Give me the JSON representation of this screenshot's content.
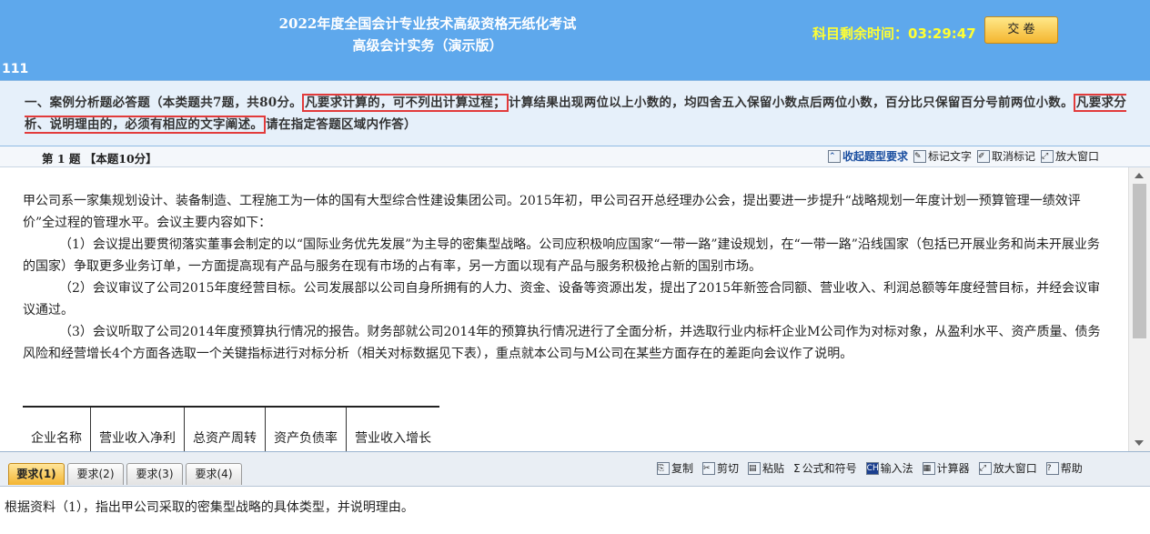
{
  "header": {
    "title_line1": "2022年度全国会计专业技术高级资格无纸化考试",
    "title_line2": "高级会计实务（演示版）",
    "timer_label": "科目剩余时间：",
    "timer_value": "03:29:47",
    "submit_label": "交 卷",
    "question_number": "111"
  },
  "instructions": {
    "part1": "一、案例分析题必答题（本类题共7题，共80分。",
    "highlight1": "凡要求计算的，可不列出计算过程；",
    "part2": "计算结果出现两位以上小数的，均四舍五入保留小数点后两位小数，百分比只保留百分号前两位小数。",
    "highlight2": "凡要求分析、说明理由的，必须有相应的文字阐述。",
    "part3": "请在指定答题区域内作答）"
  },
  "question_bar": {
    "title": "第 1 题  【本题10分】",
    "collapse_label": "收起题型要求",
    "mark_text_label": "标记文字",
    "unmark_label": "取消标记",
    "enlarge_label": "放大窗口"
  },
  "content": {
    "p1": "甲公司系一家集规划设计、装备制造、工程施工为一体的国有大型综合性建设集团公司。2015年初，甲公司召开总经理办公会，提出要进一步提升“战略规划一年度计划一预算管理一绩效评价”全过程的管理水平。会议主要内容如下：",
    "p2": "（1）会议提出要贯彻落实董事会制定的以“国际业务优先发展”为主导的密集型战略。公司应积极响应国家“一带一路”建设规划，在“一带一路”沿线国家（包括已开展业务和尚未开展业务的国家）争取更多业务订单，一方面提高现有产品与服务在现有市场的占有率，另一方面以现有产品与服务积极抢占新的国别市场。",
    "p3": "（2）会议审议了公司2015年度经营目标。公司发展部以公司自身所拥有的人力、资金、设备等资源出发，提出了2015年新签合同额、营业收入、利润总额等年度经营目标，并经会议审议通过。",
    "p4": "（3）会议听取了公司2014年度预算执行情况的报告。财务部就公司2014年的预算执行情况进行了全面分析，并选取行业内标杆企业M公司作为对标对象，从盈利水平、资产质量、债务风险和经营增长4个方面各选取一个关键指标进行对标分析（相关对标数据见下表），重点就本公司与M公司在某些方面存在的差距向会议作了说明。",
    "table_headers": [
      "企业名称",
      "营业收入净利",
      "总资产周转",
      "资产负债率",
      "营业收入增长"
    ]
  },
  "tabs": [
    {
      "label": "要求(1)",
      "active": true
    },
    {
      "label": "要求(2)",
      "active": false
    },
    {
      "label": "要求(3)",
      "active": false
    },
    {
      "label": "要求(4)",
      "active": false
    }
  ],
  "tools": {
    "copy": "复制",
    "cut": "剪切",
    "paste": "粘贴",
    "formula": "公式和符号",
    "ime": "输入法",
    "calculator": "计算器",
    "enlarge": "放大窗口",
    "help": "帮助"
  },
  "answer": {
    "prompt": "根据资料（1），指出甲公司采取的密集型战略的具体类型，并说明理由。"
  },
  "colors": {
    "header_bg": "#5ea8ec",
    "timer": "#ffff33",
    "highlight_border": "#e23b3b",
    "active_tab": "#f3b533"
  }
}
